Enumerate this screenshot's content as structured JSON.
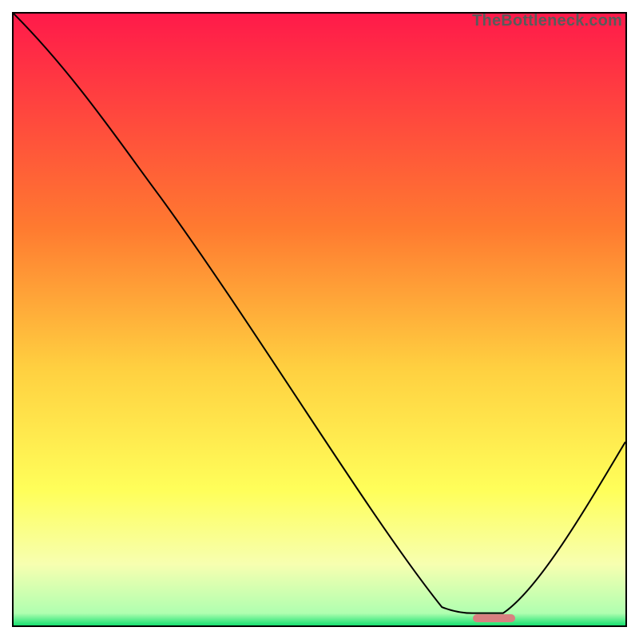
{
  "attribution": "TheBottleneck.com",
  "colors": {
    "gradient_top": "#ff1a4a",
    "gradient_mid1": "#ff7a30",
    "gradient_mid2": "#ffd040",
    "gradient_mid3": "#ffff5a",
    "gradient_mid4": "#f7ffb0",
    "gradient_bottom": "#18e070",
    "curve": "#000000",
    "frame": "#000000",
    "marker": "#d88080"
  },
  "chart_data": {
    "type": "line",
    "title": "",
    "xlabel": "",
    "ylabel": "",
    "xlim": [
      0,
      100
    ],
    "ylim": [
      0,
      100
    ],
    "grid": false,
    "legend": false,
    "annotations": [
      "TheBottleneck.com"
    ],
    "series": [
      {
        "name": "bottleneck-curve",
        "x": [
          0,
          18,
          24,
          70,
          75,
          80,
          100
        ],
        "values": [
          100,
          78,
          70,
          3,
          2,
          2,
          30
        ]
      }
    ],
    "marker": {
      "x_start": 75,
      "x_end": 82,
      "y": 0.8
    },
    "gradient_stops": [
      {
        "offset": 0,
        "color": "#ff1a4a"
      },
      {
        "offset": 35,
        "color": "#ff7a30"
      },
      {
        "offset": 58,
        "color": "#ffd040"
      },
      {
        "offset": 78,
        "color": "#ffff5a"
      },
      {
        "offset": 90,
        "color": "#f7ffb0"
      },
      {
        "offset": 98,
        "color": "#b0ffb0"
      },
      {
        "offset": 100,
        "color": "#18e070"
      }
    ]
  }
}
